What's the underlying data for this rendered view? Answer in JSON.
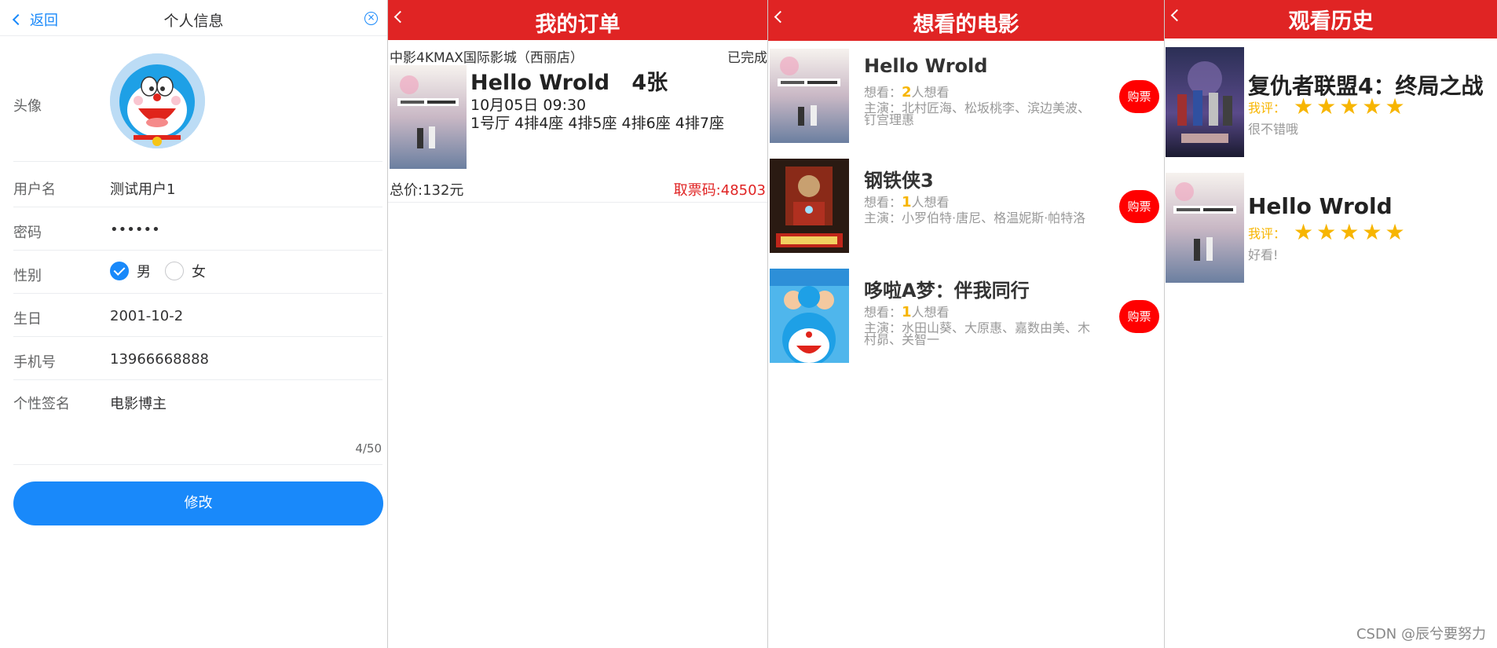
{
  "profile": {
    "nav": {
      "back_label": "返回",
      "title": "个人信息",
      "close_icon": "close-circle-icon"
    },
    "avatar_label": "头像",
    "fields": [
      {
        "label": "用户名",
        "value": "测试用户1"
      },
      {
        "label": "密码",
        "value": "••••••"
      },
      {
        "label": "性别",
        "value": ""
      },
      {
        "label": "生日",
        "value": "2001-10-2"
      },
      {
        "label": "手机号",
        "value": "13966668888"
      },
      {
        "label": "个性签名",
        "value": "电影博主"
      }
    ],
    "gender": {
      "male": "男",
      "female": "女",
      "selected": "男"
    },
    "signature_count": "4/50",
    "submit_label": "修改",
    "accent": "#1989fa"
  },
  "orders": {
    "title": "我的订单",
    "header_color": "#e02424",
    "items": [
      {
        "cinema": "中影4KMAX国际影城（西丽店）",
        "status": "已完成",
        "movie": "Hello Wrold",
        "tickets": "4张",
        "datetime": "10月05日  09:30",
        "seats": "1号厅   4排4座   4排5座   4排6座   4排7座",
        "total": "总价:132元",
        "code": "取票码:48503"
      }
    ]
  },
  "wishlist": {
    "title": "想看的电影",
    "buy_label": "购票",
    "items": [
      {
        "title": "Hello Wrold",
        "want_prefix": "想看：",
        "want_count": "2",
        "want_suffix": "人想看",
        "actors": "主演：北村匠海、松坂桃李、滨边美波、钉宫理惠"
      },
      {
        "title": "钢铁侠3",
        "want_prefix": "想看：",
        "want_count": "1",
        "want_suffix": "人想看",
        "actors": "主演：小罗伯特·唐尼、格温妮斯·帕特洛"
      },
      {
        "title": "哆啦A梦：伴我同行",
        "want_prefix": "想看：",
        "want_count": "1",
        "want_suffix": "人想看",
        "actors": "主演：水田山葵、大原惠、嘉数由美、木村昴、关智一"
      }
    ]
  },
  "history": {
    "title": "观看历史",
    "rating_label": "我评：",
    "items": [
      {
        "title": "复仇者联盟4：终局之战",
        "stars": 5,
        "comment": "很不错哦"
      },
      {
        "title": "Hello Wrold",
        "stars": 5,
        "comment": "好看!"
      }
    ]
  },
  "watermark": "CSDN @辰兮要努力"
}
